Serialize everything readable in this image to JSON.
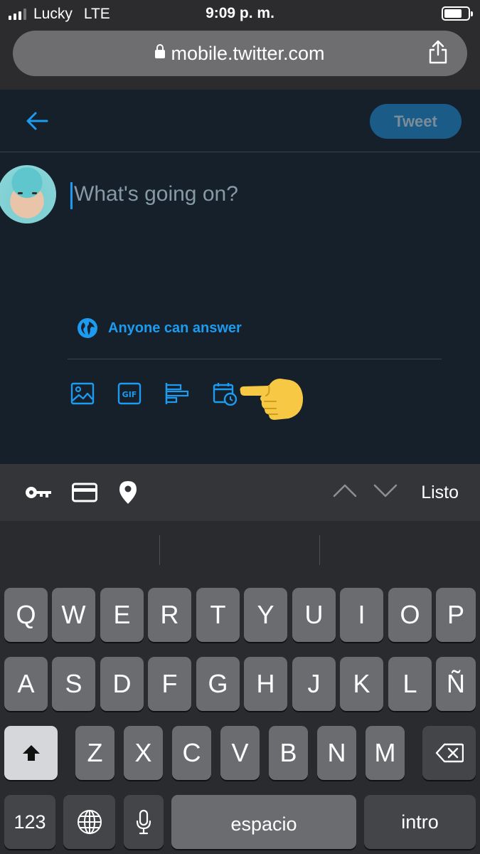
{
  "status_bar": {
    "carrier": "Lucky",
    "network": "LTE",
    "time": "9:09 p. m."
  },
  "browser": {
    "url": "mobile.twitter.com"
  },
  "compose": {
    "tweet_button": "Tweet",
    "placeholder": "What's going on?",
    "reply_setting": "Anyone can answer"
  },
  "accessory_bar": {
    "done_label": "Listo"
  },
  "keyboard": {
    "row1": [
      "Q",
      "W",
      "E",
      "R",
      "T",
      "Y",
      "U",
      "I",
      "O",
      "P"
    ],
    "row2": [
      "A",
      "S",
      "D",
      "F",
      "G",
      "H",
      "J",
      "K",
      "L",
      "Ñ"
    ],
    "row3": [
      "Z",
      "X",
      "C",
      "V",
      "B",
      "N",
      "M"
    ],
    "numbers_label": "123",
    "space_label": "espacio",
    "return_label": "intro"
  },
  "colors": {
    "accent": "#1d9bf0",
    "background": "#15202b",
    "tweet_button_bg": "#1a5b88"
  }
}
